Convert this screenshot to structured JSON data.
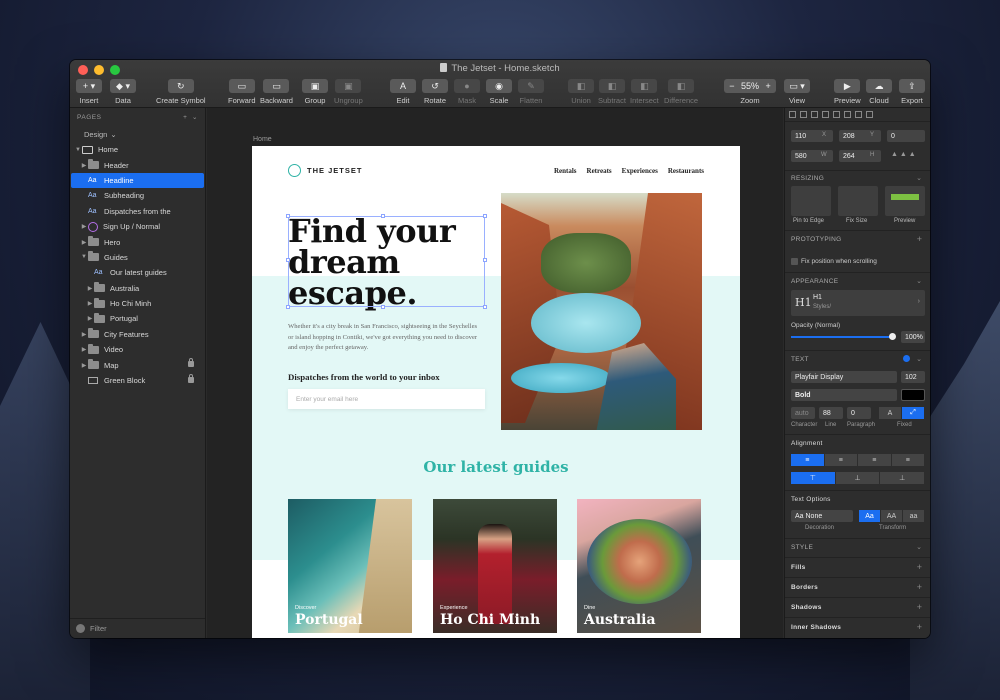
{
  "window": {
    "title": "The Jetset - Home.sketch"
  },
  "toolbar": {
    "insert": "Insert",
    "data": "Data",
    "create_symbol": "Create Symbol",
    "forward": "Forward",
    "backward": "Backward",
    "group": "Group",
    "ungroup": "Ungroup",
    "edit": "Edit",
    "rotate": "Rotate",
    "mask": "Mask",
    "scale": "Scale",
    "flatten": "Flatten",
    "union": "Union",
    "subtract": "Subtract",
    "intersect": "Intersect",
    "difference": "Difference",
    "zoom": "Zoom",
    "zoom_value": "55%",
    "view": "View",
    "preview": "Preview",
    "cloud": "Cloud",
    "export": "Export"
  },
  "sidebar": {
    "pages_header": "PAGES",
    "pages_current": "Design",
    "artboard": "Home",
    "layers": [
      {
        "label": "Header",
        "kind": "folder"
      },
      {
        "label": "Headline",
        "kind": "text",
        "selected": true
      },
      {
        "label": "Subheading",
        "kind": "text"
      },
      {
        "label": "Dispatches from the",
        "kind": "text"
      },
      {
        "label": "Sign Up / Normal",
        "kind": "symbol"
      },
      {
        "label": "Hero",
        "kind": "folder"
      },
      {
        "label": "Guides",
        "kind": "folder",
        "open": true
      },
      {
        "label": "Our latest guides",
        "kind": "text"
      },
      {
        "label": "Australia",
        "kind": "folder"
      },
      {
        "label": "Ho Chi Minh",
        "kind": "folder"
      },
      {
        "label": "Portugal",
        "kind": "folder"
      },
      {
        "label": "City Features",
        "kind": "folder"
      },
      {
        "label": "Video",
        "kind": "folder"
      },
      {
        "label": "Map",
        "kind": "folder",
        "locked": true
      },
      {
        "label": "Green Block",
        "kind": "rect",
        "locked": true
      }
    ],
    "filter": "Filter"
  },
  "canvas": {
    "artboard_label": "Home",
    "logo": "THE JETSET",
    "nav": [
      "Rentals",
      "Retreats",
      "Experiences",
      "Restaurants"
    ],
    "headline": "Find your dream escape.",
    "body": "Whether it's a city break in San Francisco, sightseeing in the Seychelles or island hopping in Contiki, we've got everything you need to discover and enjoy the perfect getaway.",
    "dispatches": "Dispatches from the world to your inbox",
    "email_placeholder": "Enter your email here",
    "guides_title": "Our latest guides",
    "cards": [
      {
        "caption": "Discover",
        "title": "Portugal"
      },
      {
        "caption": "Experience",
        "title": "Ho Chi Minh"
      },
      {
        "caption": "Dine",
        "title": "Australia"
      }
    ]
  },
  "inspector": {
    "x": "110",
    "x_label": "X",
    "y": "208",
    "y_label": "Y",
    "rotation": "0",
    "w": "580",
    "w_label": "W",
    "h": "264",
    "h_label": "H",
    "resizing": "RESIZING",
    "pin_to_edge": "Pin to Edge",
    "fix_size": "Fix Size",
    "preview": "Preview",
    "prototyping": "PROTOTYPING",
    "fix_scroll": "Fix position when scrolling",
    "appearance": "APPEARANCE",
    "style_name": "H1",
    "style_sub": "Styles/",
    "opacity_label": "Opacity (Normal)",
    "opacity_value": "100%",
    "text": "TEXT",
    "font": "Playfair Display",
    "font_size": "102",
    "weight": "Bold",
    "char": "auto",
    "line": "88",
    "para": "0",
    "char_label": "Character",
    "line_label": "Line",
    "para_label": "Paragraph",
    "fixed_label": "Fixed",
    "alignment": "Alignment",
    "text_options": "Text Options",
    "decoration": "Aa None",
    "decoration_label": "Decoration",
    "transform_label": "Transform",
    "transform_opts": [
      "Aa",
      "AA",
      "aa"
    ],
    "style": "STYLE",
    "fills": "Fills",
    "borders": "Borders",
    "shadows": "Shadows",
    "inner_shadows": "Inner Shadows"
  }
}
